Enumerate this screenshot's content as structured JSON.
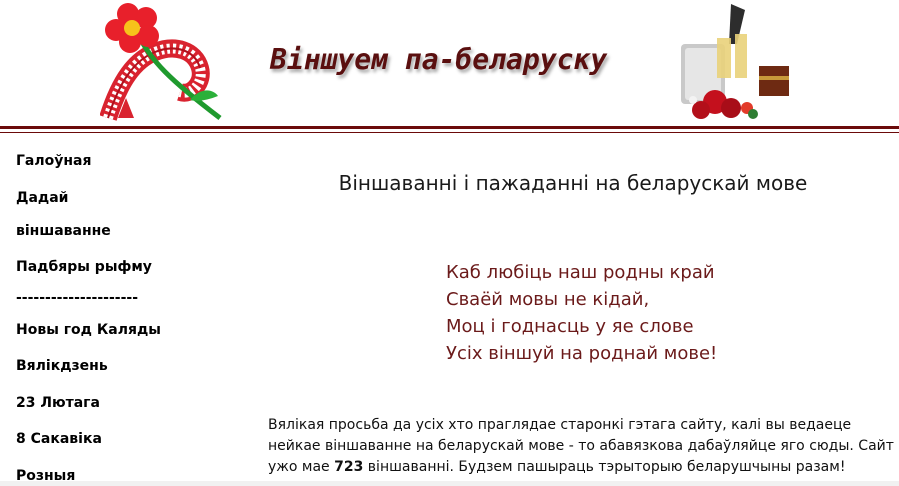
{
  "header": {
    "site_title": "Віншуем па-беларуску"
  },
  "sidebar": {
    "items": [
      {
        "label": "Галоўная"
      },
      {
        "label": "Дадай"
      },
      {
        "label": "віншаванне"
      },
      {
        "label": "Падбяры рыфму"
      },
      {
        "label": "---------------------"
      },
      {
        "label": "Новы год Каляды"
      },
      {
        "label": "Вялікдзень"
      },
      {
        "label": "23 Лютага"
      },
      {
        "label": "8 Сакавіка"
      },
      {
        "label": "Розныя"
      }
    ]
  },
  "main": {
    "heading": "Віншаванні і пажаданні на беларускай мове",
    "poem": [
      "Каб любіць наш родны край",
      "Сваёй мовы не кідай,",
      "Моц і годнасць у яе слове",
      "Усіх віншуй на роднай мове!"
    ],
    "intro_part1": "Вялікая просьба да усіх хто праглядае старонкі гэтага сайту, калі вы ведаеце нейкае віншаванне на беларускай мове - то абавязкова дабаўляйце яго сюды. Сайт ужо мае ",
    "intro_count": "723",
    "intro_part2": " віншаванні. Будзем пашыраць тэрыторыю беларушчыны разам!"
  },
  "colors": {
    "accent": "#6b0a0a",
    "title": "#5a0f0f",
    "poem": "#6b1a1a"
  }
}
